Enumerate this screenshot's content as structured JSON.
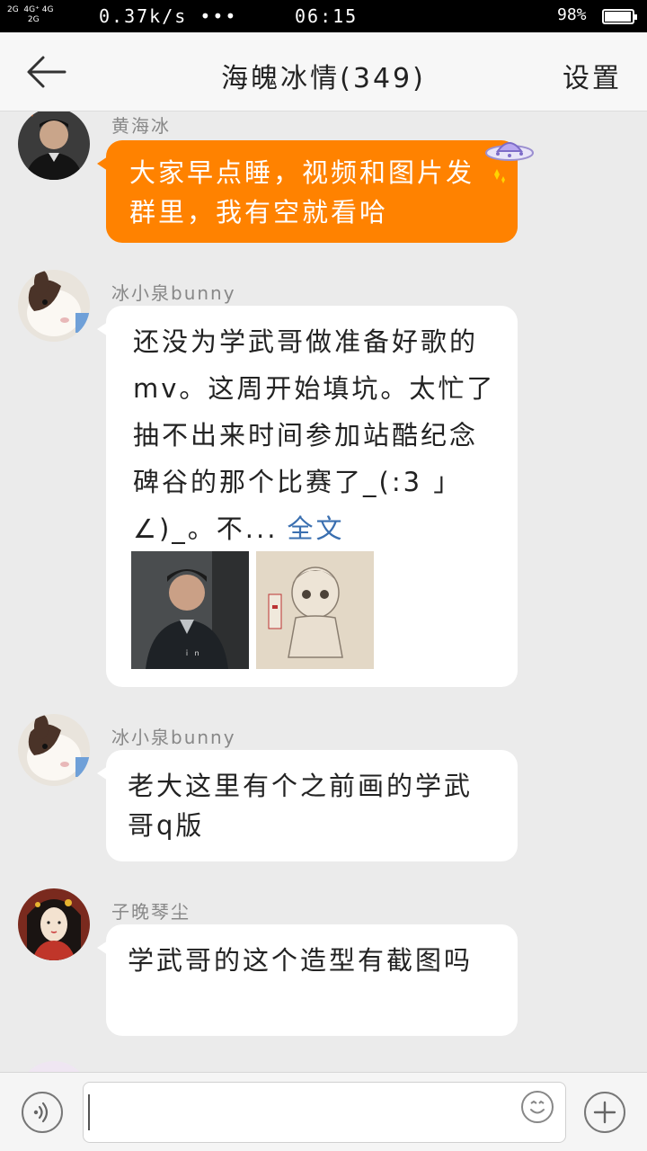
{
  "status_bar": {
    "network": "2G  4G+ 4G\n    2G",
    "speed": "0.37k/s •••",
    "time": "06:15",
    "battery": "98%",
    "battery_level": 0.98
  },
  "header": {
    "back_icon": "arrow-left-icon",
    "title": "海魄冰情(349)",
    "settings_label": "设置"
  },
  "messages": [
    {
      "sender": "黄海冰",
      "text": "大家早点睡，视频和图片发群里，我有空就看哈",
      "bubble_color": "#ff8200",
      "decoration": "ufo-icon"
    },
    {
      "sender": "冰小泉bunny",
      "text": "还没为学武哥做准备好歌的mv。这周开始填坑。太忙了抽不出来时间参加站酷纪念碑谷的那个比赛了_(:3 」∠)_。不...",
      "more_label": "全文",
      "images": [
        "photo-man-in-coat",
        "sketch-drawing"
      ]
    },
    {
      "sender": "冰小泉bunny",
      "text": "老大这里有个之前画的学武哥q版"
    },
    {
      "sender": "子晚琴尘",
      "text": "学武哥的这个造型有截图吗"
    }
  ],
  "input_bar": {
    "voice_icon": "voice-icon",
    "placeholder": "",
    "emoji_icon": "smiley-icon",
    "plus_icon": "plus-icon"
  }
}
